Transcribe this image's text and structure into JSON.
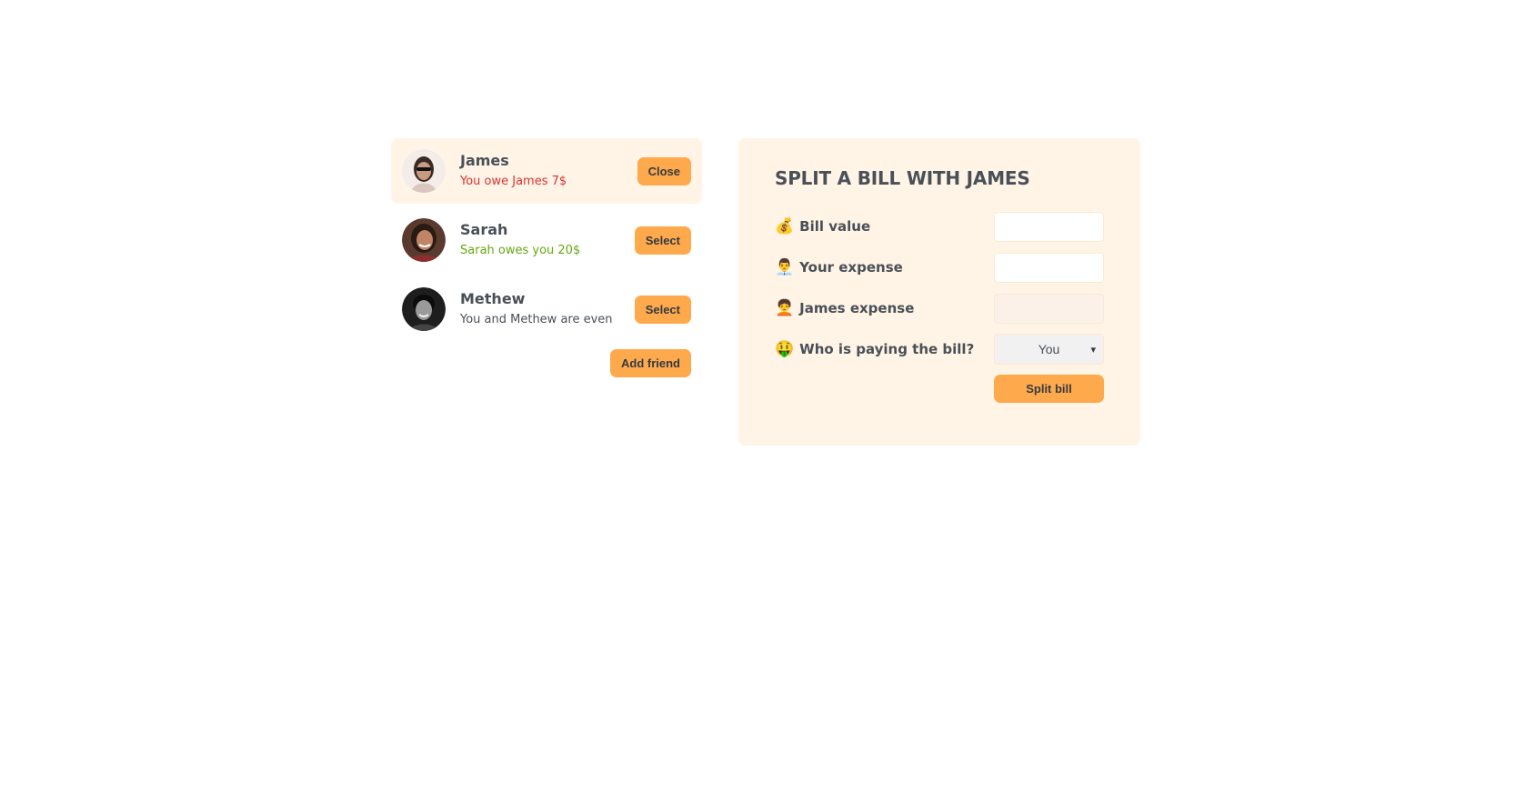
{
  "friends": [
    {
      "name": "James",
      "balance": "You owe James 7$",
      "balance_type": "red",
      "button": "Close",
      "selected": true
    },
    {
      "name": "Sarah",
      "balance": "Sarah owes you 20$",
      "balance_type": "green",
      "button": "Select",
      "selected": false
    },
    {
      "name": "Methew",
      "balance": "You and Methew are even",
      "balance_type": "neutral",
      "button": "Select",
      "selected": false
    }
  ],
  "sidebar": {
    "add_friend_label": "Add friend"
  },
  "form": {
    "title": "SPLIT A BILL WITH JAMES",
    "bill_value": {
      "icon": "💰",
      "label": "Bill value",
      "value": ""
    },
    "your_expense": {
      "icon": "👨‍💼",
      "label": "Your expense",
      "value": ""
    },
    "friend_expense": {
      "icon": "🧑‍🦱",
      "label": "James expense",
      "value": ""
    },
    "payer": {
      "icon": "🤑",
      "label": "Who is paying the bill?",
      "selected": "You"
    },
    "submit_label": "Split bill"
  },
  "colors": {
    "accent": "#ffa94d",
    "panel": "#fff4e6",
    "owe": "#e03131",
    "owed": "#66a80f",
    "text": "#495057"
  }
}
